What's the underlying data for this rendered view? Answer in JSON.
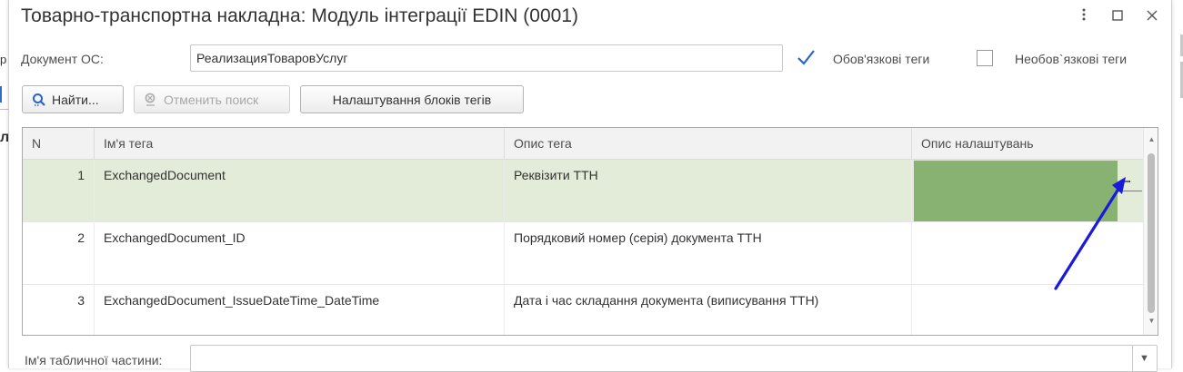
{
  "window": {
    "title": "Товарно-транспортна накладна: Модуль інтеграції EDIN (0001)",
    "menu_icon": "more-vertical-icon",
    "maximize_icon": "maximize-icon",
    "close_icon": "close-icon"
  },
  "background_fragments": {
    "frag_1": "р",
    "frag_2": "л"
  },
  "form": {
    "doc_label": "Документ ОС:",
    "doc_value": "РеализацияТоваровУслуг",
    "mandatory_label": "Обов'язкові теги",
    "mandatory_checked": true,
    "optional_label": "Необов`язкові теги",
    "optional_checked": false,
    "table_part_label": "Ім'я табличної частини:",
    "table_part_value": ""
  },
  "toolbar": {
    "find_label": "Найти...",
    "cancel_search_label": "Отменить поиск",
    "settings_label": "Налаштування блоків тегів"
  },
  "table": {
    "headers": [
      "N",
      "Ім'я тега",
      "Опис тега",
      "Опис налаштувань"
    ],
    "rows": [
      {
        "n": "1",
        "name": "ExchangedDocument",
        "desc": "Реквізити ТТН",
        "settings": ""
      },
      {
        "n": "2",
        "name": "ExchangedDocument_ID",
        "desc": "Порядковий номер (серія) документа ТТН",
        "settings": ""
      },
      {
        "n": "3",
        "name": "ExchangedDocument_IssueDateTime_DateTime",
        "desc": "Дата і час складання документа (виписування ТТН)",
        "settings": ""
      }
    ],
    "selected_row": 1,
    "edit_button": "...",
    "selected_cell_color": "#88b272",
    "selected_row_color": "#e3ebd9"
  },
  "annotation": {
    "arrow_color": "#1a1adb",
    "arrow_icon": "arrow-icon"
  }
}
